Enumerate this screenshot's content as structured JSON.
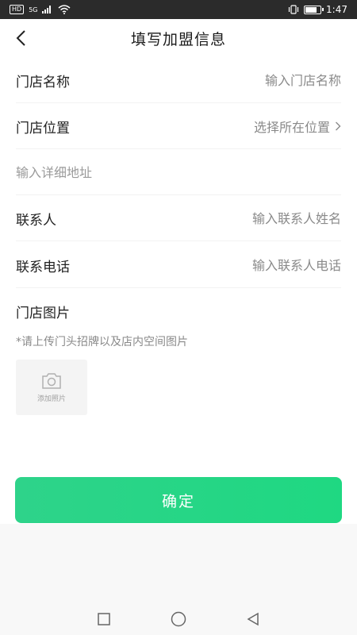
{
  "status_bar": {
    "network_badge": "HD",
    "signal_label": "5G",
    "time": "1:47"
  },
  "nav": {
    "title": "填写加盟信息",
    "back_icon": "chevron-left-icon"
  },
  "form": {
    "store_name": {
      "label": "门店名称",
      "placeholder": "输入门店名称"
    },
    "store_location": {
      "label": "门店位置",
      "value": "选择所在位置",
      "icon": "chevron-right-icon"
    },
    "detail_address": {
      "placeholder": "输入详细地址"
    },
    "contact": {
      "label": "联系人",
      "placeholder": "输入联系人姓名"
    },
    "phone": {
      "label": "联系电话",
      "placeholder": "输入联系人电话"
    }
  },
  "photos": {
    "title": "门店图片",
    "hint": "*请上传门头招牌以及店内空间图片",
    "upload_label": "添加照片",
    "upload_icon": "camera-icon"
  },
  "confirm_button": "确定",
  "colors": {
    "accent": "#22d685",
    "placeholder": "#8a8a8a",
    "status_bar": "#2b2b2b"
  }
}
